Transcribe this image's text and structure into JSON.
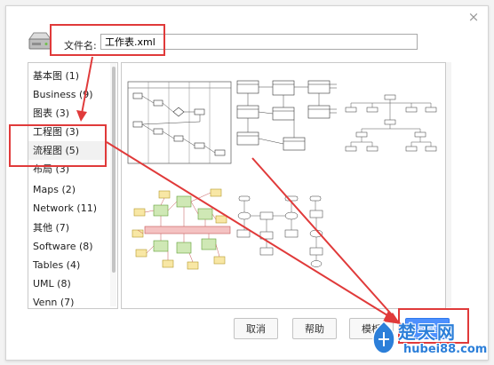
{
  "dialog": {
    "close_glyph": "×",
    "filename_label": "文件名:",
    "filename_value": "工作表.xml"
  },
  "categories": [
    {
      "label": "基本图 (1)"
    },
    {
      "label": "Business (9)"
    },
    {
      "label": "图表 (3)"
    },
    {
      "label": "工程图 (3)"
    },
    {
      "label": "流程图 (5)",
      "selected": true
    },
    {
      "label": "布局 (3)"
    },
    {
      "label": "Maps (2)"
    },
    {
      "label": "Network (11)"
    },
    {
      "label": "其他 (7)"
    },
    {
      "label": "Software (8)"
    },
    {
      "label": "Tables (4)"
    },
    {
      "label": "UML (8)"
    },
    {
      "label": "Venn (7)"
    }
  ],
  "templates": [
    {
      "name": "cross-functional-flowchart"
    },
    {
      "name": "data-flow-diagram"
    },
    {
      "name": "decision-tree"
    },
    {
      "name": "color-flowchart"
    },
    {
      "name": "process-flowchart"
    }
  ],
  "buttons": {
    "cancel": "取消",
    "help": "帮助",
    "third": "模板",
    "create": "创建"
  },
  "watermark": {
    "title": "楚天网",
    "url": "hubei88.com"
  },
  "colors": {
    "highlight": "#e03a3a",
    "primary_button": "#4d90fe",
    "watermark": "#2c7fd9"
  }
}
